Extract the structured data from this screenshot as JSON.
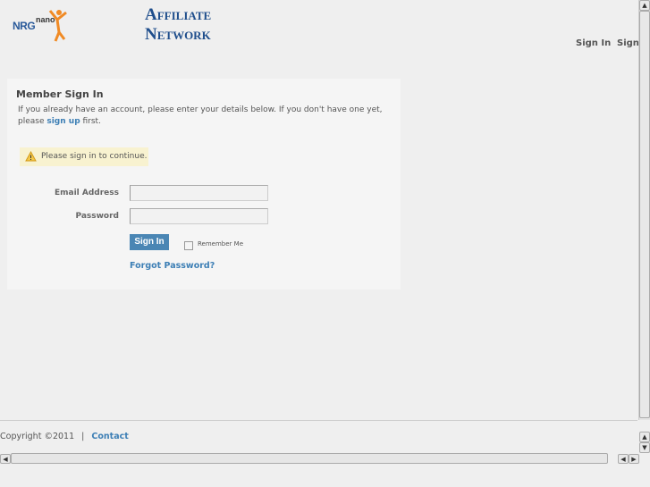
{
  "header": {
    "logo_text": "NRGnano",
    "title_line1": "Affiliate",
    "title_line2": "Network",
    "nav": [
      "Sign In",
      "Sign"
    ]
  },
  "signin": {
    "heading": "Member Sign In",
    "intro_before": "If you already have an account, please enter your details below. If you don't have one yet, please ",
    "signup_link": "sign up",
    "intro_after": " first.",
    "warning": "Please sign in to continue.",
    "email_label": "Email Address",
    "email_value": "",
    "password_label": "Password",
    "password_value": "",
    "submit": "Sign In",
    "remember": "Remember Me",
    "forgot": "Forgot Password?"
  },
  "footer": {
    "copyright": "Copyright ©2011",
    "separator": "|",
    "contact": "Contact"
  },
  "colors": {
    "accent": "#4a86b4",
    "title": "#1f4e8c",
    "warning_bg": "#f8f2d0"
  }
}
